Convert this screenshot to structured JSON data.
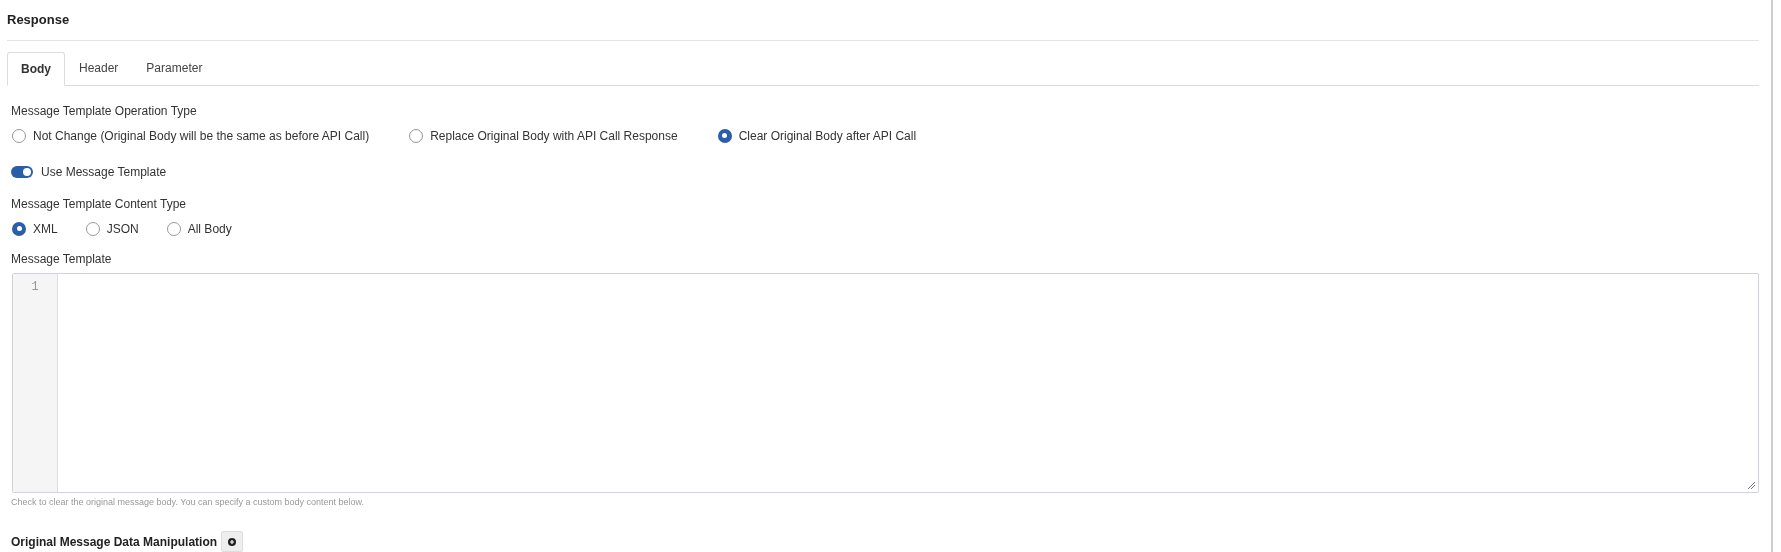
{
  "section_title": "Response",
  "tabs": [
    {
      "label": "Body",
      "selected": true
    },
    {
      "label": "Header",
      "selected": false
    },
    {
      "label": "Parameter",
      "selected": false
    }
  ],
  "operation_type": {
    "label": "Message Template Operation Type",
    "options": [
      {
        "label": "Not Change (Original Body will be the same as before API Call)",
        "selected": false
      },
      {
        "label": "Replace Original Body with API Call Response",
        "selected": false
      },
      {
        "label": "Clear Original Body after API Call",
        "selected": true
      }
    ]
  },
  "use_template": {
    "label": "Use Message Template",
    "on": true
  },
  "content_type": {
    "label": "Message Template Content Type",
    "options": [
      {
        "label": "XML",
        "selected": true
      },
      {
        "label": "JSON",
        "selected": false
      },
      {
        "label": "All Body",
        "selected": false
      }
    ]
  },
  "editor": {
    "label": "Message Template",
    "line_numbers": [
      "1"
    ],
    "hint": "Check to clear the original message body. You can specify a custom body content below."
  },
  "manipulation": {
    "title": "Original Message Data Manipulation"
  }
}
